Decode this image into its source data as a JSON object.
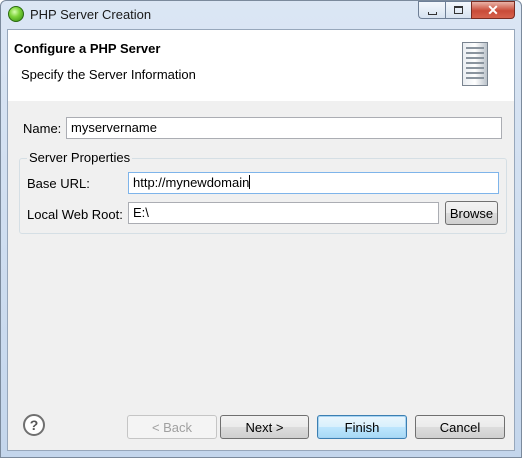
{
  "window": {
    "title": "PHP Server Creation",
    "close_glyph": "✕"
  },
  "banner": {
    "title": "Configure a PHP Server",
    "description": "Specify the Server Information",
    "icon": "server-icon"
  },
  "form": {
    "name_label": "Name:",
    "name_value": "myservername",
    "group_label": "Server Properties",
    "base_url_label": "Base URL:",
    "base_url_value": "http://mynewdomain",
    "web_root_label": "Local Web Root:",
    "web_root_value": "E:\\",
    "browse_label": "Browse"
  },
  "footer": {
    "help_glyph": "?",
    "back_label": "< Back",
    "next_label": "Next >",
    "finish_label": "Finish",
    "cancel_label": "Cancel"
  }
}
